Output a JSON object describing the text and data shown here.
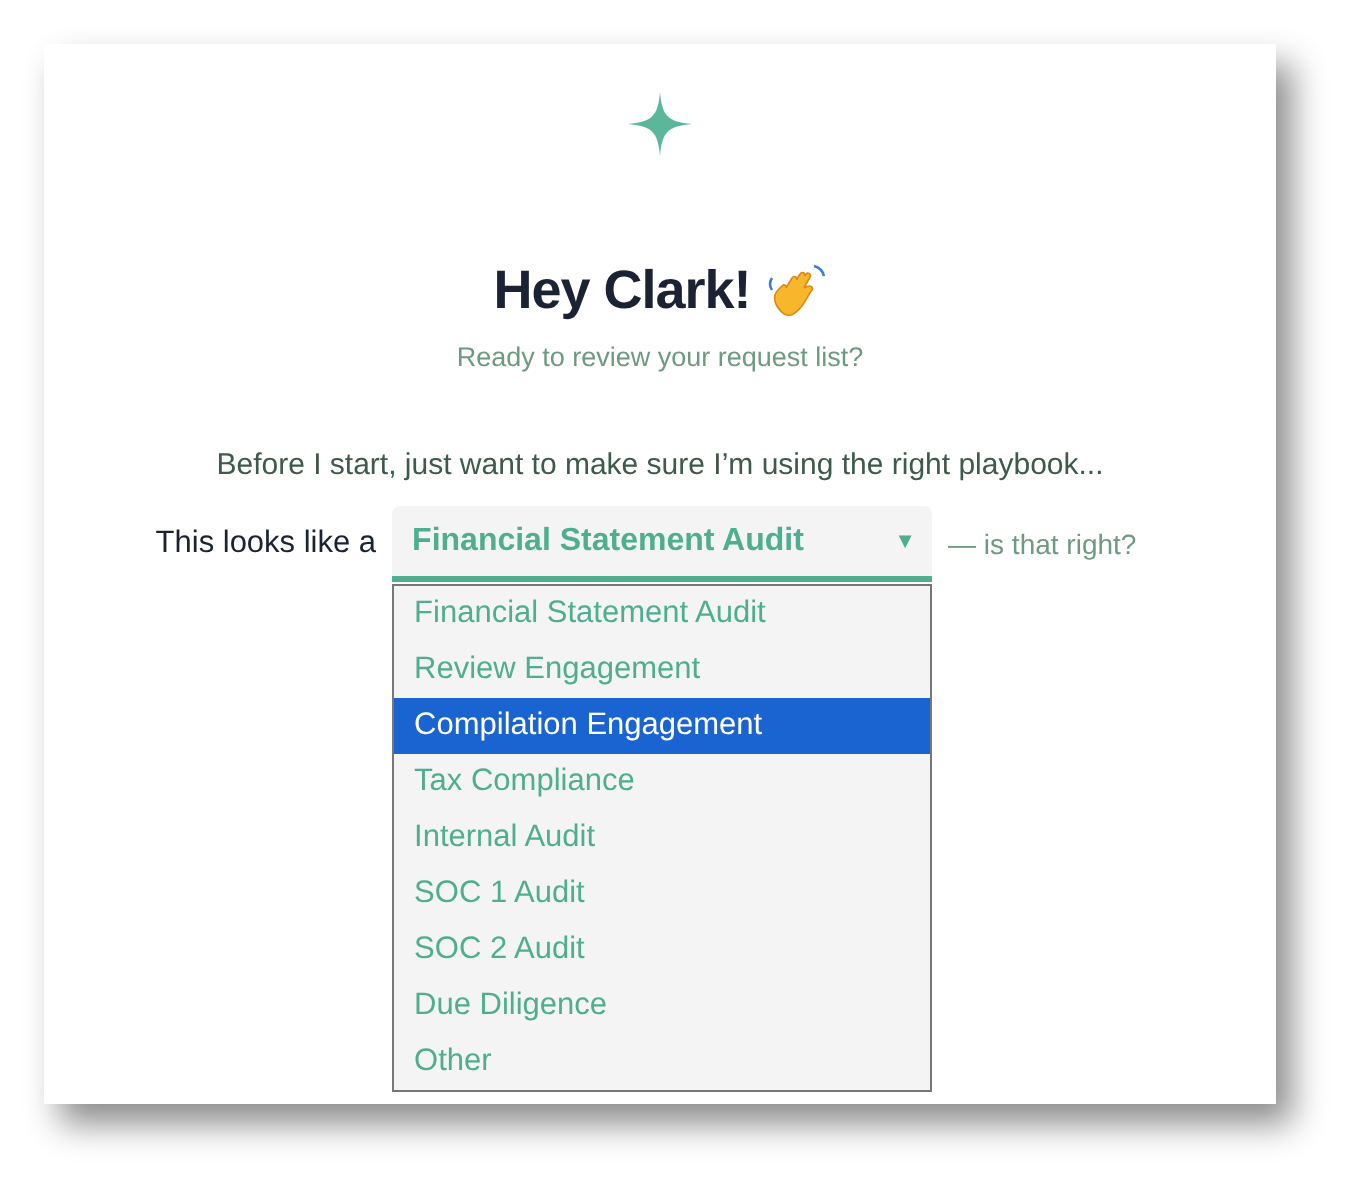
{
  "greeting": {
    "title": "Hey Clark!",
    "subtitle": "Ready to review your request list?"
  },
  "prompt": "Before I start, just want to make sure I’m using the right playbook...",
  "question": {
    "label": "This looks like a",
    "value": "Financial Statement Audit",
    "caret": "▼",
    "suffix": "— is that right?"
  },
  "options": [
    {
      "label": "Financial Statement Audit",
      "selected": false
    },
    {
      "label": "Review Engagement",
      "selected": false
    },
    {
      "label": "Compilation Engagement",
      "selected": true
    },
    {
      "label": "Tax Compliance",
      "selected": false
    },
    {
      "label": "Internal Audit",
      "selected": false
    },
    {
      "label": "SOC 1 Audit",
      "selected": false
    },
    {
      "label": "SOC 2 Audit",
      "selected": false
    },
    {
      "label": "Due Diligence",
      "selected": false
    },
    {
      "label": "Other",
      "selected": false
    }
  ]
}
